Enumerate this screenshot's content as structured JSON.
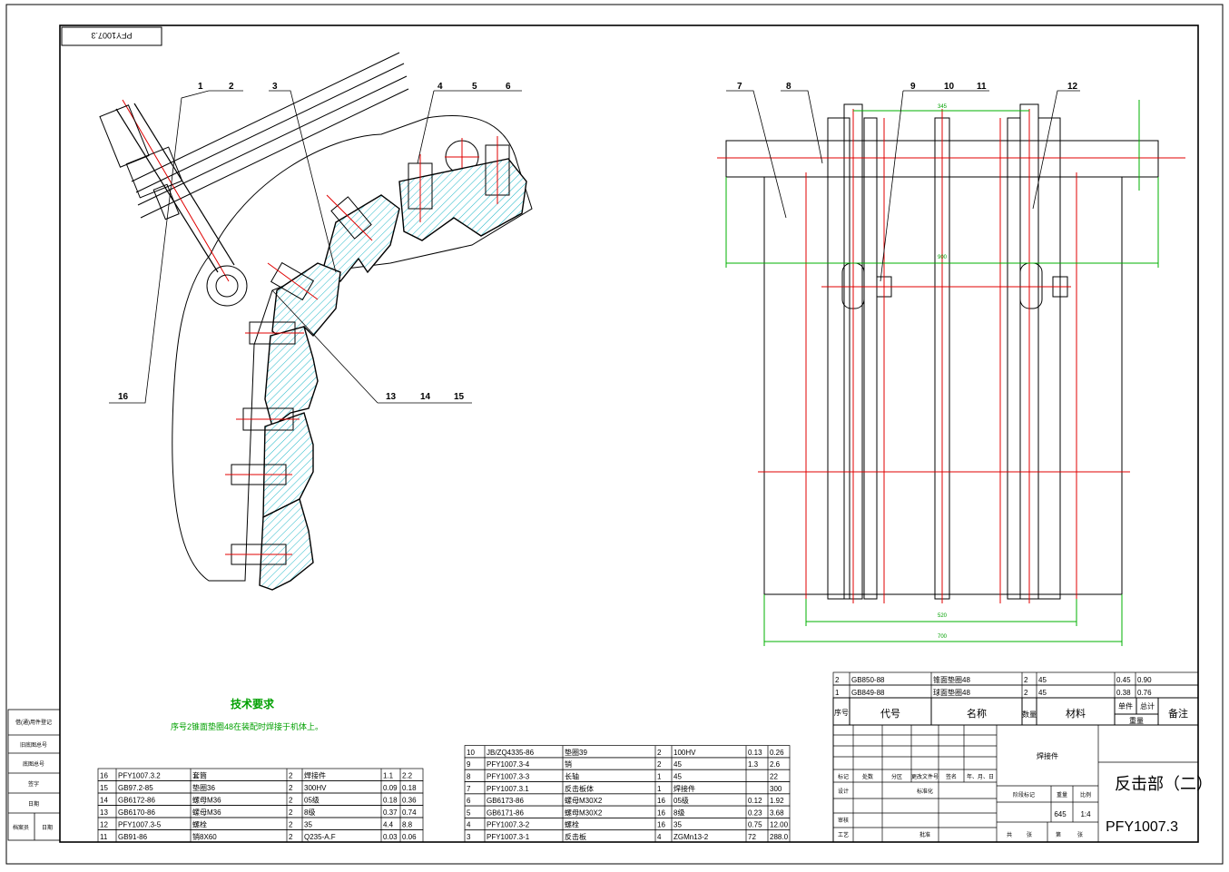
{
  "drawing": {
    "corner_tag": "PFY1007.3",
    "tech_req_title": "技术要求",
    "tech_req_text": "序号2锥面垫圈48在装配时焊接于机体上。",
    "title": "反击部（二）",
    "code": "PFY1007.3",
    "weld_label": "焊接件",
    "weight": "645",
    "scale": "1:4"
  },
  "balloons": {
    "left": [
      "1",
      "2",
      "3",
      "4",
      "5",
      "6",
      "13",
      "14",
      "15",
      "16"
    ],
    "right": [
      "7",
      "8",
      "9",
      "10",
      "11",
      "12"
    ]
  },
  "dimensions": [
    "345",
    "900",
    "520",
    "700"
  ],
  "left_bom": [
    {
      "no": "16",
      "code": "PFY1007.3.2",
      "name": "套筒",
      "qty": "2",
      "mat": "焊接件",
      "w1": "1.1",
      "w2": "2.2"
    },
    {
      "no": "15",
      "code": "GB97.2-85",
      "name": "垫圈36",
      "qty": "2",
      "mat": "300HV",
      "w1": "0.09",
      "w2": "0.18"
    },
    {
      "no": "14",
      "code": "GB6172-86",
      "name": "螺母M36",
      "qty": "2",
      "mat": "05级",
      "w1": "0.18",
      "w2": "0.36"
    },
    {
      "no": "13",
      "code": "GB6170-86",
      "name": "螺母M36",
      "qty": "2",
      "mat": "8级",
      "w1": "0.37",
      "w2": "0.74"
    },
    {
      "no": "12",
      "code": "PFY1007.3-5",
      "name": "螺栓",
      "qty": "2",
      "mat": "35",
      "w1": "4.4",
      "w2": "8.8"
    },
    {
      "no": "11",
      "code": "GB91-86",
      "name": "销8X60",
      "qty": "2",
      "mat": "Q235-A.F",
      "w1": "0.03",
      "w2": "0.06"
    }
  ],
  "mid_bom": [
    {
      "no": "10",
      "code": "JB/ZQ4335-86",
      "name": "垫圈39",
      "qty": "2",
      "mat": "100HV",
      "w1": "0.13",
      "w2": "0.26"
    },
    {
      "no": "9",
      "code": "PFY1007.3-4",
      "name": "销",
      "qty": "2",
      "mat": "45",
      "w1": "1.3",
      "w2": "2.6"
    },
    {
      "no": "8",
      "code": "PFY1007.3-3",
      "name": "长轴",
      "qty": "1",
      "mat": "45",
      "w1": "",
      "w2": "22"
    },
    {
      "no": "7",
      "code": "PFY1007.3.1",
      "name": "反击板体",
      "qty": "1",
      "mat": "焊接件",
      "w1": "",
      "w2": "300"
    },
    {
      "no": "6",
      "code": "GB6173-86",
      "name": "螺母M30X2",
      "qty": "16",
      "mat": "05级",
      "w1": "0.12",
      "w2": "1.92"
    },
    {
      "no": "5",
      "code": "GB6171-86",
      "name": "螺母M30X2",
      "qty": "16",
      "mat": "8级",
      "w1": "0.23",
      "w2": "3.68"
    },
    {
      "no": "4",
      "code": "PFY1007.3-2",
      "name": "螺栓",
      "qty": "16",
      "mat": "35",
      "w1": "0.75",
      "w2": "12.00"
    },
    {
      "no": "3",
      "code": "PFY1007.3-1",
      "name": "反击板",
      "qty": "4",
      "mat": "ZGMn13-2",
      "w1": "72",
      "w2": "288.0"
    }
  ],
  "right_bom": [
    {
      "no": "2",
      "code": "GB850-88",
      "name": "锥面垫圈48",
      "qty": "2",
      "mat": "45",
      "w1": "0.45",
      "w2": "0.90"
    },
    {
      "no": "1",
      "code": "GB849-88",
      "name": "球面垫圈48",
      "qty": "2",
      "mat": "45",
      "w1": "0.38",
      "w2": "0.76"
    }
  ],
  "bom_header": {
    "no": "序号",
    "code": "代号",
    "name": "名称",
    "qty": "数量",
    "mat": "材料",
    "unit": "单件",
    "total": "总计",
    "weight": "重量",
    "note": "备注"
  },
  "side_cells": [
    "借(通)用件登记",
    "旧底图总号",
    "底图总号",
    "签字",
    "日期",
    "档案员",
    "日期"
  ],
  "title_block_cells": [
    "标记",
    "处数",
    "分区",
    "更改文件号",
    "签名",
    "年、月、日",
    "设计",
    "标准化",
    "阶段标记",
    "重量",
    "比例",
    "审核",
    "工艺",
    "批准",
    "共",
    "张",
    "第",
    "张"
  ]
}
